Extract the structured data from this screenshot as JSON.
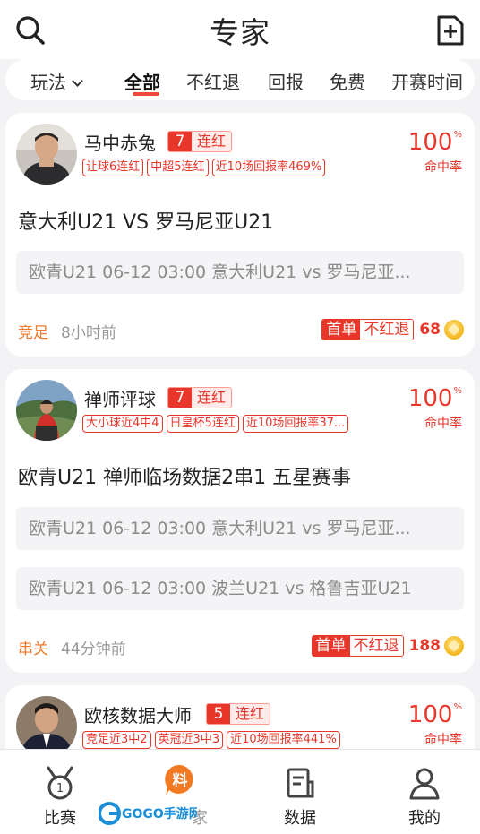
{
  "header": {
    "title": "专家"
  },
  "filters": {
    "play_label": "玩法",
    "items": [
      "全部",
      "不红退",
      "回报",
      "免费",
      "开赛时间"
    ]
  },
  "cards": [
    {
      "name": "马中赤兔",
      "streak_num": "7",
      "streak_label": "连红",
      "tags": [
        "让球6连红",
        "中超5连红",
        "近10场回报率469%"
      ],
      "rate": "100",
      "rate_unit": "%",
      "rate_label": "命中率",
      "headline": "意大利U21 VS 罗马尼亚U21",
      "matches": [
        "欧青U21  06-12 03:00  意大利U21 vs 罗马尼亚..."
      ],
      "type": "竞足",
      "time": "8小时前",
      "badge_a": "首单",
      "badge_b": "不红退",
      "price": "68"
    },
    {
      "name": "禅师评球",
      "streak_num": "7",
      "streak_label": "连红",
      "tags": [
        "大小球近4中4",
        "日皇杯5连红",
        "近10场回报率37..."
      ],
      "rate": "100",
      "rate_unit": "%",
      "rate_label": "命中率",
      "headline": "欧青U21 禅师临场数据2串1 五星赛事",
      "matches": [
        "欧青U21  06-12 03:00  意大利U21 vs 罗马尼亚...",
        "欧青U21  06-12 03:00  波兰U21 vs 格鲁吉亚U21"
      ],
      "type": "串关",
      "time": "44分钟前",
      "badge_a": "首单",
      "badge_b": "不红退",
      "price": "188"
    },
    {
      "name": "欧核数据大师",
      "streak_num": "5",
      "streak_label": "连红",
      "tags": [
        "竞足近3中2",
        "英冠近3中3",
        "近10场回报率441%"
      ],
      "rate": "100",
      "rate_unit": "%",
      "rate_label": "命中率"
    }
  ],
  "tabbar": [
    "比赛",
    "料",
    "数据",
    "我的"
  ],
  "tabbar_partial_label": "家",
  "watermark": "GOGO手游网",
  "colors": {
    "accent": "#e8362a",
    "orange": "#f07a2c"
  },
  "icons": [
    "search-icon",
    "add-doc-icon",
    "medal-icon",
    "liao-icon",
    "data-doc-icon",
    "person-icon",
    "coin-icon"
  ]
}
